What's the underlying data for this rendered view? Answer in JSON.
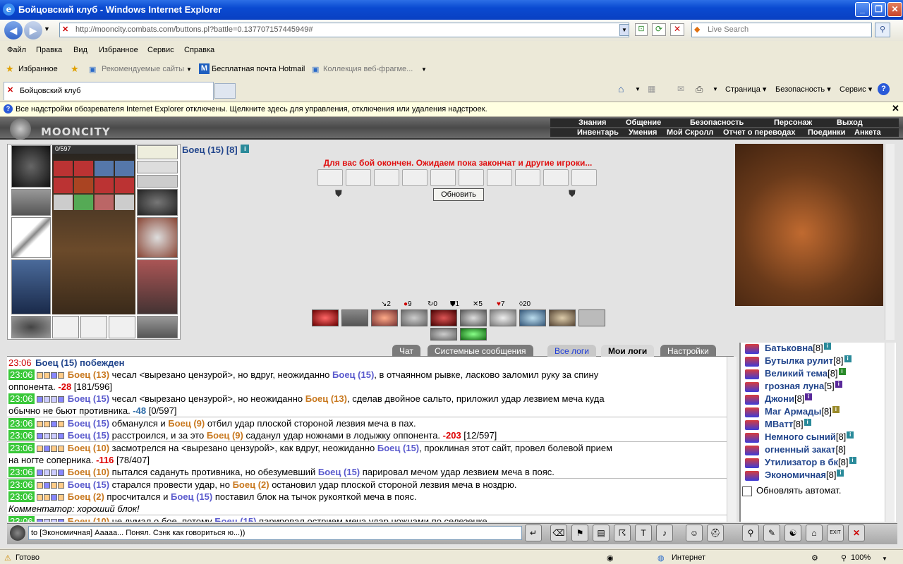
{
  "window": {
    "title": "Бойцовский клуб - Windows Internet Explorer",
    "url": "http://mooncity.combats.com/buttons.pl?battle=0.137707157445949#",
    "search_placeholder": "Live Search"
  },
  "menu": [
    "Файл",
    "Правка",
    "Вид",
    "Избранное",
    "Сервис",
    "Справка"
  ],
  "favbar": {
    "favorites": "Избранное",
    "recommended": "Рекомендуемые сайты",
    "hotmail": "Бесплатная почта Hotmail",
    "gallery": "Коллекция веб-фрагме..."
  },
  "tab": {
    "title": "Бойцовский клуб"
  },
  "commandbar": {
    "page": "Страница",
    "security": "Безопасность",
    "tools": "Сервис"
  },
  "infobar": "Все надстройки обозревателя Internet Explorer отключены. Щелкните здесь для управления, отключения или удаления надстроек.",
  "game": {
    "logo": "MOONCITY",
    "topmenu": [
      "Знания",
      "Общение",
      "Безопасность",
      "Персонаж",
      "Выход"
    ],
    "submenu": [
      "Инвентарь",
      "Умения",
      "Мой Скролл",
      "Отчет о переводах",
      "Поединки",
      "Анкета"
    ],
    "hp": "0/597",
    "fighter": "Боец (15) [8]",
    "battle_msg": "Для вас бой окончен. Ожидаем пока закончат и другие игроки...",
    "refresh": "Обновить",
    "stats": [
      "2",
      "9",
      "0",
      "1",
      "5",
      "7",
      "20"
    ]
  },
  "logtabs": [
    "Чат",
    "Системные сообщения",
    "Все логи",
    "Мои логи",
    "Настройки"
  ],
  "log": [
    {
      "time": "23:06",
      "text": "Боец (15) побежден"
    },
    {
      "time": "23:06",
      "a": "Боец (13)",
      "t1": " чесал <вырезано цензурой>, но вдруг, неожиданно ",
      "b": "Боец (15)",
      "t2": ", в отчаянном рывке, ласково заломил руку за спину"
    },
    {
      "cont": "оппонента. ",
      "dmg": "-28",
      "hp": " [181/596]"
    },
    {
      "time": "23:06",
      "a": "Боец (15)",
      "t1": " чесал <вырезано цензурой>, но неожиданно ",
      "b": "Боец (13)",
      "t2": ", сделав двойное сальто, приложил удар лезвием меча куда"
    },
    {
      "cont": "обычно не бьют противника. ",
      "dmg": "-48",
      "hp": " [0/597]"
    },
    {
      "time": "23:06",
      "a": "Боец (15)",
      "t1": " обманулся и ",
      "b": "Боец (9)",
      "t2": " отбил удар плоской стороной лезвия меча в пах."
    },
    {
      "time": "23:06",
      "a": "Боец (15)",
      "t1": " расстроился, и за это ",
      "b": "Боец (9)",
      "t2": " саданул удар ножнами в лодыжку оппонента. ",
      "dmg": "-203",
      "hp": " [12/597]"
    },
    {
      "time": "23:06",
      "a": "Боец (10)",
      "t1": " засмотрелся на <вырезано цензурой>, как вдруг, неожиданно ",
      "b": "Боец (15)",
      "t2": ", проклиная этот сайт, провел болевой прием"
    },
    {
      "cont": "на ногте соперника. ",
      "dmg": "-116",
      "hp": " [78/407]"
    },
    {
      "time": "23:06",
      "a": "Боец (10)",
      "t1": " пытался садануть противника, но обезумевший ",
      "b": "Боец (15)",
      "t2": " парировал мечом удар лезвием меча в пояс."
    },
    {
      "time": "23:06",
      "a": "Боец (15)",
      "t1": " старался провести удар, но ",
      "b": "Боец (2)",
      "t2": " остановил удар плоской стороной лезвия меча в ноздрю."
    },
    {
      "time": "23:06",
      "a": "Боец (2)",
      "t1": " просчитался и ",
      "b": "Боец (15)",
      "t2": " поставил блок на тычок рукояткой меча в пояс."
    },
    {
      "comment": "Комментатор: хороший блок!"
    },
    {
      "time": "23:06",
      "a": "Боец (10)",
      "t1": " не думал о бое, потому ",
      "b": "Боец (15)",
      "t2": " парировал острием меча удар ножнами по селезенке."
    }
  ],
  "users": [
    {
      "name": "Батьковна",
      "lvl": "[8]"
    },
    {
      "name": "Бутылка рулит",
      "lvl": "[8]"
    },
    {
      "name": "Великий тема",
      "lvl": "[8]"
    },
    {
      "name": "грозная луна",
      "lvl": "[5]"
    },
    {
      "name": "Джони",
      "lvl": "[8]"
    },
    {
      "name": "Маг Армады",
      "lvl": "[8]"
    },
    {
      "name": "МВатт",
      "lvl": "[8]"
    },
    {
      "name": "Немного сыний",
      "lvl": "[8]"
    },
    {
      "name": "огненный закат",
      "lvl": "[8]"
    },
    {
      "name": "Утилизатор в бк",
      "lvl": "[8]"
    },
    {
      "name": "Экономичная",
      "lvl": "[8]"
    }
  ],
  "autoupdate": "Обновлять автомат.",
  "chat_input": "to [Экономичная] Ааааа... Понял. Сэнк как говориться ю...))",
  "statusbar": {
    "status": "Готово",
    "zone": "Интернет",
    "zoom": "100%"
  }
}
